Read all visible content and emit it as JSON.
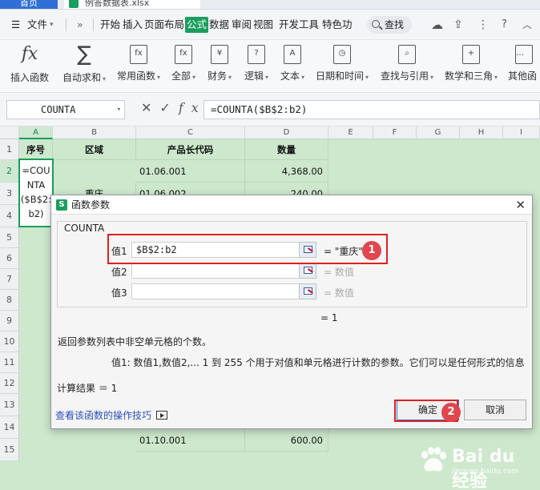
{
  "titlebar": {
    "home_tab": "首页",
    "file_name": "例答数据表.xlsx"
  },
  "menu": {
    "file": "文件",
    "more": "»",
    "tabs": [
      "开始",
      "插入",
      "页面布局",
      "公式",
      "数据",
      "审阅",
      "视图",
      "开发工具",
      "特色功"
    ],
    "active_tab": "公式",
    "search": "查找"
  },
  "ribbon": {
    "buttons": [
      {
        "label": "插入函数",
        "icon": "fx-icon",
        "glyph": "fx"
      },
      {
        "label": "自动求和",
        "icon": "sigma-icon",
        "glyph": "∑"
      },
      {
        "label": "常用函数",
        "icon": "common-func-icon",
        "glyph": "fx"
      },
      {
        "label": "全部",
        "icon": "all-func-icon",
        "glyph": "fx"
      },
      {
        "label": "财务",
        "icon": "finance-icon",
        "glyph": "¥"
      },
      {
        "label": "逻辑",
        "icon": "logic-icon",
        "glyph": "?"
      },
      {
        "label": "文本",
        "icon": "text-icon",
        "glyph": "A"
      },
      {
        "label": "日期和时间",
        "icon": "clock-icon",
        "glyph": "◷"
      },
      {
        "label": "查找与引用",
        "icon": "lookup-icon",
        "glyph": "⌕"
      },
      {
        "label": "数学和三角",
        "icon": "math-icon",
        "glyph": "+"
      },
      {
        "label": "其他函",
        "icon": "other-func-icon",
        "glyph": "…"
      }
    ]
  },
  "formula_bar": {
    "name_box": "COUNTA",
    "formula": "=COUNTA($B$2:b2)",
    "fx_label": "fx"
  },
  "grid": {
    "columns": [
      "A",
      "B",
      "C",
      "D",
      "E",
      "F",
      "G",
      "H",
      "I"
    ],
    "rows": [
      "1",
      "2",
      "3",
      "4",
      "5",
      "6",
      "7",
      "8",
      "9",
      "10",
      "11",
      "12",
      "13",
      "14",
      "15"
    ],
    "header_row": [
      "序号",
      "区域",
      "产品长代码",
      "数量"
    ],
    "row2": {
      "code": "01.06.001",
      "qty": "4,368.00"
    },
    "row3": {
      "region": "重庆",
      "code": "01.06.002",
      "qty": "240.00"
    },
    "row14": {
      "code": "01.10.001",
      "qty": "600.00"
    },
    "active_cell_text": "=COUNTA($B$2:b2)"
  },
  "dialog": {
    "title": "函数参数",
    "function_name": "COUNTA",
    "args": [
      {
        "label": "值1",
        "value": "$B$2:b2",
        "result": "= \"重庆\""
      },
      {
        "label": "值2",
        "value": "",
        "result": "= 数值"
      },
      {
        "label": "值3",
        "value": "",
        "result": "= 数值"
      }
    ],
    "total_result": "= 1",
    "description": "返回参数列表中非空单元格的个数。",
    "arg_description": "值1:  数值1,数值2,... 1 到 255 个用于对值和单元格进行计数的参数。它们可以是任何形式的信息",
    "calc_result": "计算结果 ＝ 1",
    "help_link": "查看该函数的操作技巧",
    "ok": "确定",
    "cancel": "取消"
  },
  "annotations": {
    "one": "1",
    "two": "2"
  },
  "watermark": {
    "text": "Bai du 经验",
    "sub": "jingyan.baidu.com"
  },
  "colors": {
    "accent_green": "#1a9e5c",
    "grid_fill": "#cde8cc",
    "annotation_red": "#e02020"
  }
}
